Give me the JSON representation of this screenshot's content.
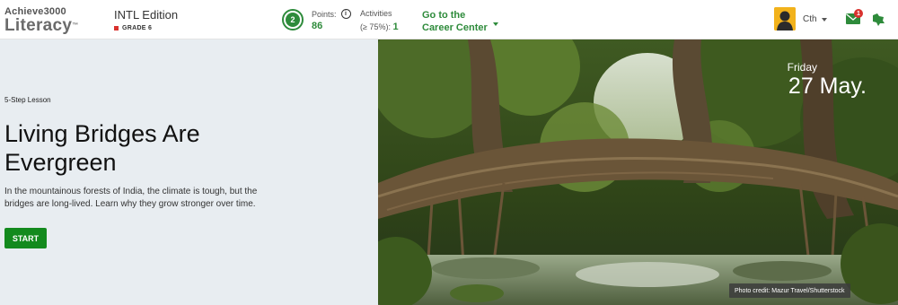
{
  "header": {
    "logo_top": "Achieve3000",
    "logo_main": "Literacy",
    "edition": "INTL Edition",
    "grade": "GRADE 6",
    "level_badge": "2",
    "points_label": "Points:",
    "points_value": "86",
    "activities_label": "Activities",
    "activities_threshold": "(≥ 75%):",
    "activities_value": "1",
    "career_line1": "Go to the",
    "career_line2": "Career Center",
    "user_name": "Cth",
    "mail_count": "1"
  },
  "lesson": {
    "step_label": "5-Step Lesson",
    "title": "Living Bridges Are Evergreen",
    "description": "In the mountainous forests of India, the climate is tough, but the bridges are long-lived. Learn why they grow stronger over time.",
    "start_label": "START"
  },
  "hero": {
    "day": "Friday",
    "date": "27 May.",
    "credit": "Photo credit: Mazur Travel/Shutterstock"
  },
  "colors": {
    "brand_green": "#2e8b3b",
    "start_green": "#138a1e",
    "alert_red": "#d9322e",
    "panel_bg": "#e8edf1"
  }
}
